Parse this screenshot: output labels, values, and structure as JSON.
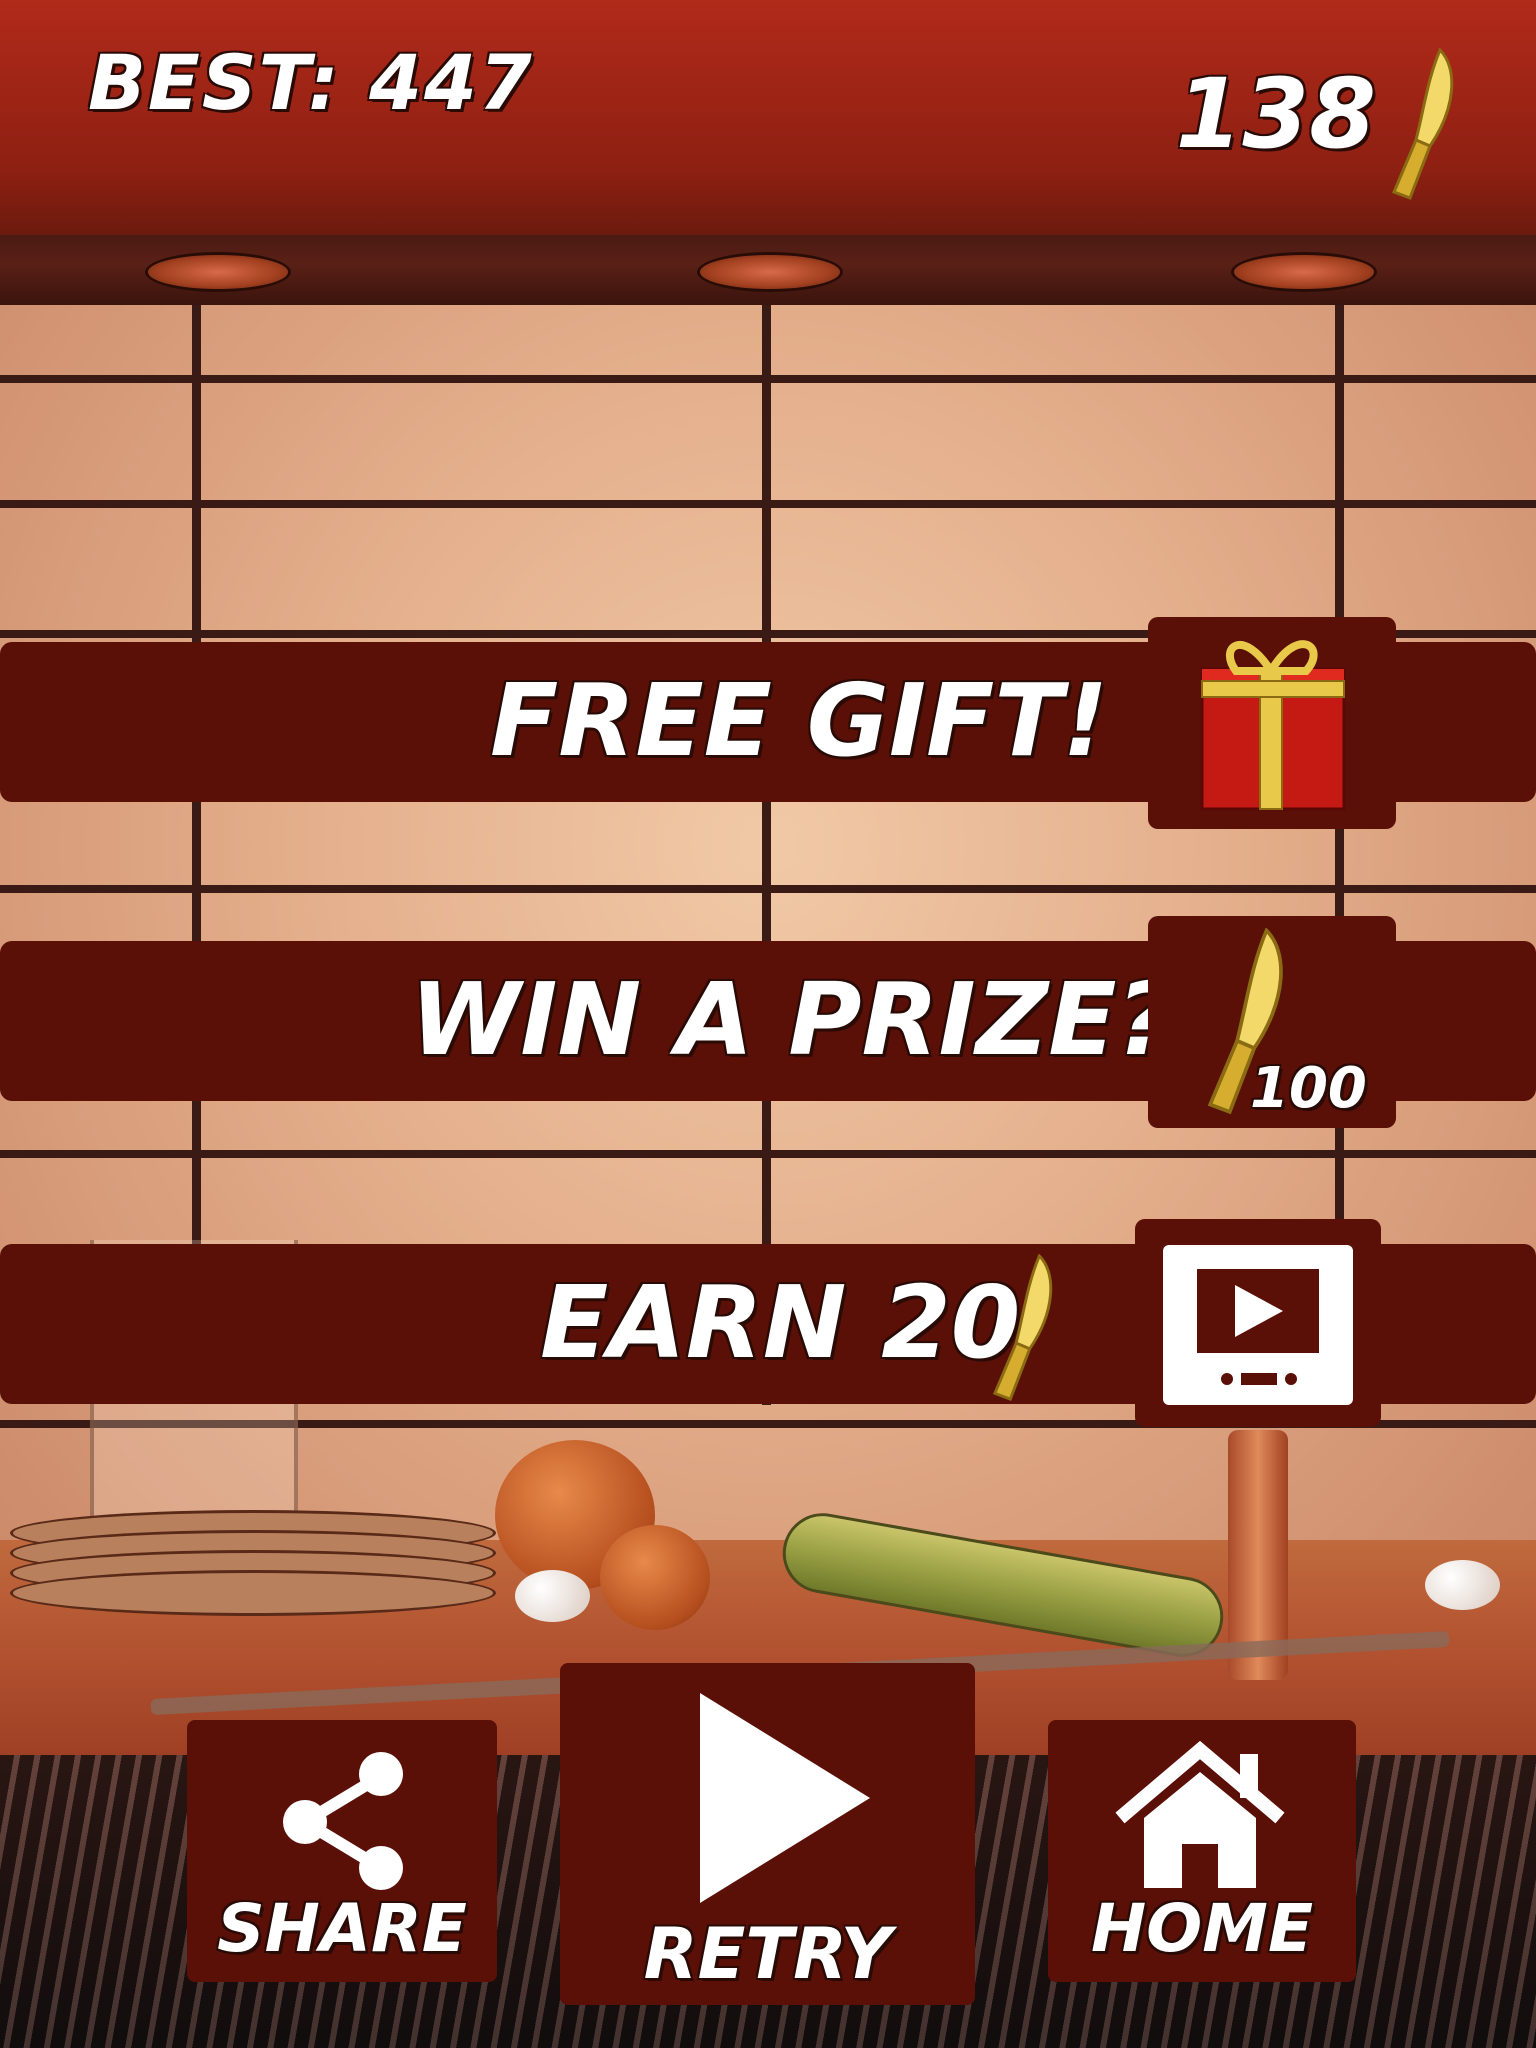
{
  "hud": {
    "best_label": "BEST: 447",
    "coins": "138",
    "coin_icon": "gold-knife-icon"
  },
  "options": [
    {
      "label": "FREE GIFT!",
      "icon": "gift-box-icon"
    },
    {
      "label": "WIN A PRIZE?",
      "icon": "gold-knife-icon",
      "cost": "100"
    },
    {
      "label": "EARN 20",
      "icon": "video-ad-icon",
      "label_icon": "gold-knife-icon"
    }
  ],
  "buttons": {
    "share": {
      "label": "SHARE",
      "icon": "share-icon"
    },
    "retry": {
      "label": "RETRY",
      "icon": "play-icon"
    },
    "home": {
      "label": "HOME",
      "icon": "home-icon"
    }
  },
  "colors": {
    "panel": "#5a0f07",
    "text": "#ffffff",
    "gold": "#e8c94a",
    "gift_red": "#c51a14"
  }
}
